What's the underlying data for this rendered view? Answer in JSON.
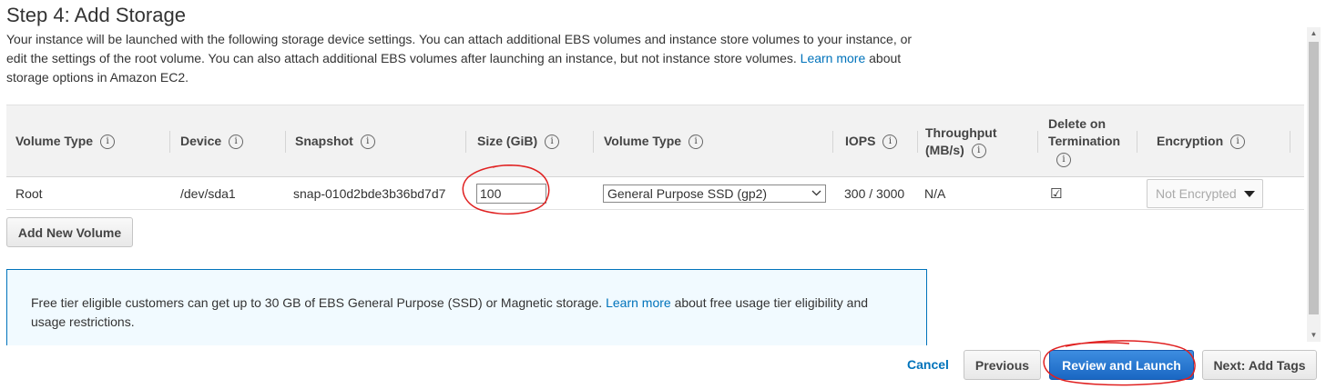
{
  "page": {
    "title": "Step 4: Add Storage",
    "intro_part1": "Your instance will be launched with the following storage device settings. You can attach additional EBS volumes and instance store volumes to your instance, or edit the settings of the root volume. You can also attach additional EBS volumes after launching an instance, but not instance store volumes. ",
    "intro_link": "Learn more",
    "intro_part2": " about storage options in Amazon EC2."
  },
  "table": {
    "headers": {
      "volume_type": "Volume Type",
      "device": "Device",
      "snapshot": "Snapshot",
      "size": "Size (GiB)",
      "ebs_volume_type": "Volume Type",
      "iops": "IOPS",
      "throughput_line1": "Throughput",
      "throughput_line2": "(MB/s)",
      "delete_line1": "Delete on",
      "delete_line2": "Termination",
      "encryption": "Encryption"
    },
    "info_glyph": "i",
    "row": {
      "volume_type": "Root",
      "device": "/dev/sda1",
      "snapshot": "snap-010d2bde3b36bd7d7",
      "size": "100",
      "ebs_volume_type": "General Purpose SSD (gp2)",
      "iops": "300 / 3000",
      "throughput": "N/A",
      "delete_on_termination": "☑",
      "encryption": "Not Encrypted"
    }
  },
  "add_volume_button": "Add New Volume",
  "info_box": {
    "text_part1": "Free tier eligible customers can get up to 30 GB of EBS General Purpose (SSD) or Magnetic storage. ",
    "link": "Learn more",
    "text_part2": " about free usage tier eligibility and usage restrictions."
  },
  "footer": {
    "cancel": "Cancel",
    "previous": "Previous",
    "review_launch": "Review and Launch",
    "next": "Next: Add Tags"
  },
  "scrollbar": {
    "up_arrow": "▲",
    "down_arrow": "▼"
  },
  "colors": {
    "link": "#0073bb",
    "primary_button": "#1a67c3",
    "annotation": "#e02020"
  }
}
